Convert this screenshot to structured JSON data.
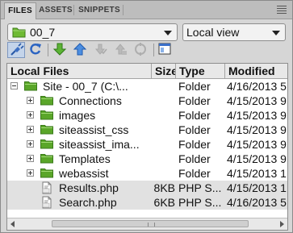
{
  "tabs": [
    {
      "label": "FILES",
      "active": true
    },
    {
      "label": "ASSETS",
      "active": false
    },
    {
      "label": "SNIPPETS",
      "active": false
    }
  ],
  "site_select": {
    "value": "00_7"
  },
  "view_select": {
    "value": "Local view"
  },
  "toolbar": {
    "buttons": [
      "connect-icon",
      "refresh-icon",
      "get-files-icon",
      "put-files-icon",
      "check-out-icon",
      "check-in-icon",
      "synchronize-icon",
      "expand-icon"
    ]
  },
  "file_list": {
    "columns": {
      "name": "Local Files",
      "size": "Size",
      "type": "Type",
      "modified": "Modified"
    },
    "rows": [
      {
        "name": "Site - 00_7 (C:\\...",
        "size": "",
        "type": "Folder",
        "modified": "4/16/2013 5",
        "kind": "site"
      },
      {
        "name": "Connections",
        "size": "",
        "type": "Folder",
        "modified": "4/15/2013 9",
        "kind": "folder"
      },
      {
        "name": "images",
        "size": "",
        "type": "Folder",
        "modified": "4/15/2013 9",
        "kind": "folder"
      },
      {
        "name": "siteassist_css",
        "size": "",
        "type": "Folder",
        "modified": "4/15/2013 9",
        "kind": "folder"
      },
      {
        "name": "siteassist_ima...",
        "size": "",
        "type": "Folder",
        "modified": "4/15/2013 9",
        "kind": "folder"
      },
      {
        "name": "Templates",
        "size": "",
        "type": "Folder",
        "modified": "4/15/2013 9",
        "kind": "folder"
      },
      {
        "name": "webassist",
        "size": "",
        "type": "Folder",
        "modified": "4/15/2013 1",
        "kind": "folder"
      },
      {
        "name": "Results.php",
        "size": "8KB",
        "type": "PHP S...",
        "modified": "4/15/2013 1",
        "kind": "file"
      },
      {
        "name": "Search.php",
        "size": "6KB",
        "type": "PHP S...",
        "modified": "4/16/2013 5",
        "kind": "file"
      }
    ]
  },
  "colors": {
    "folder": "#5aa629",
    "selected_row": "#e1e1e1",
    "panel_bg": "#d6d6d6"
  }
}
